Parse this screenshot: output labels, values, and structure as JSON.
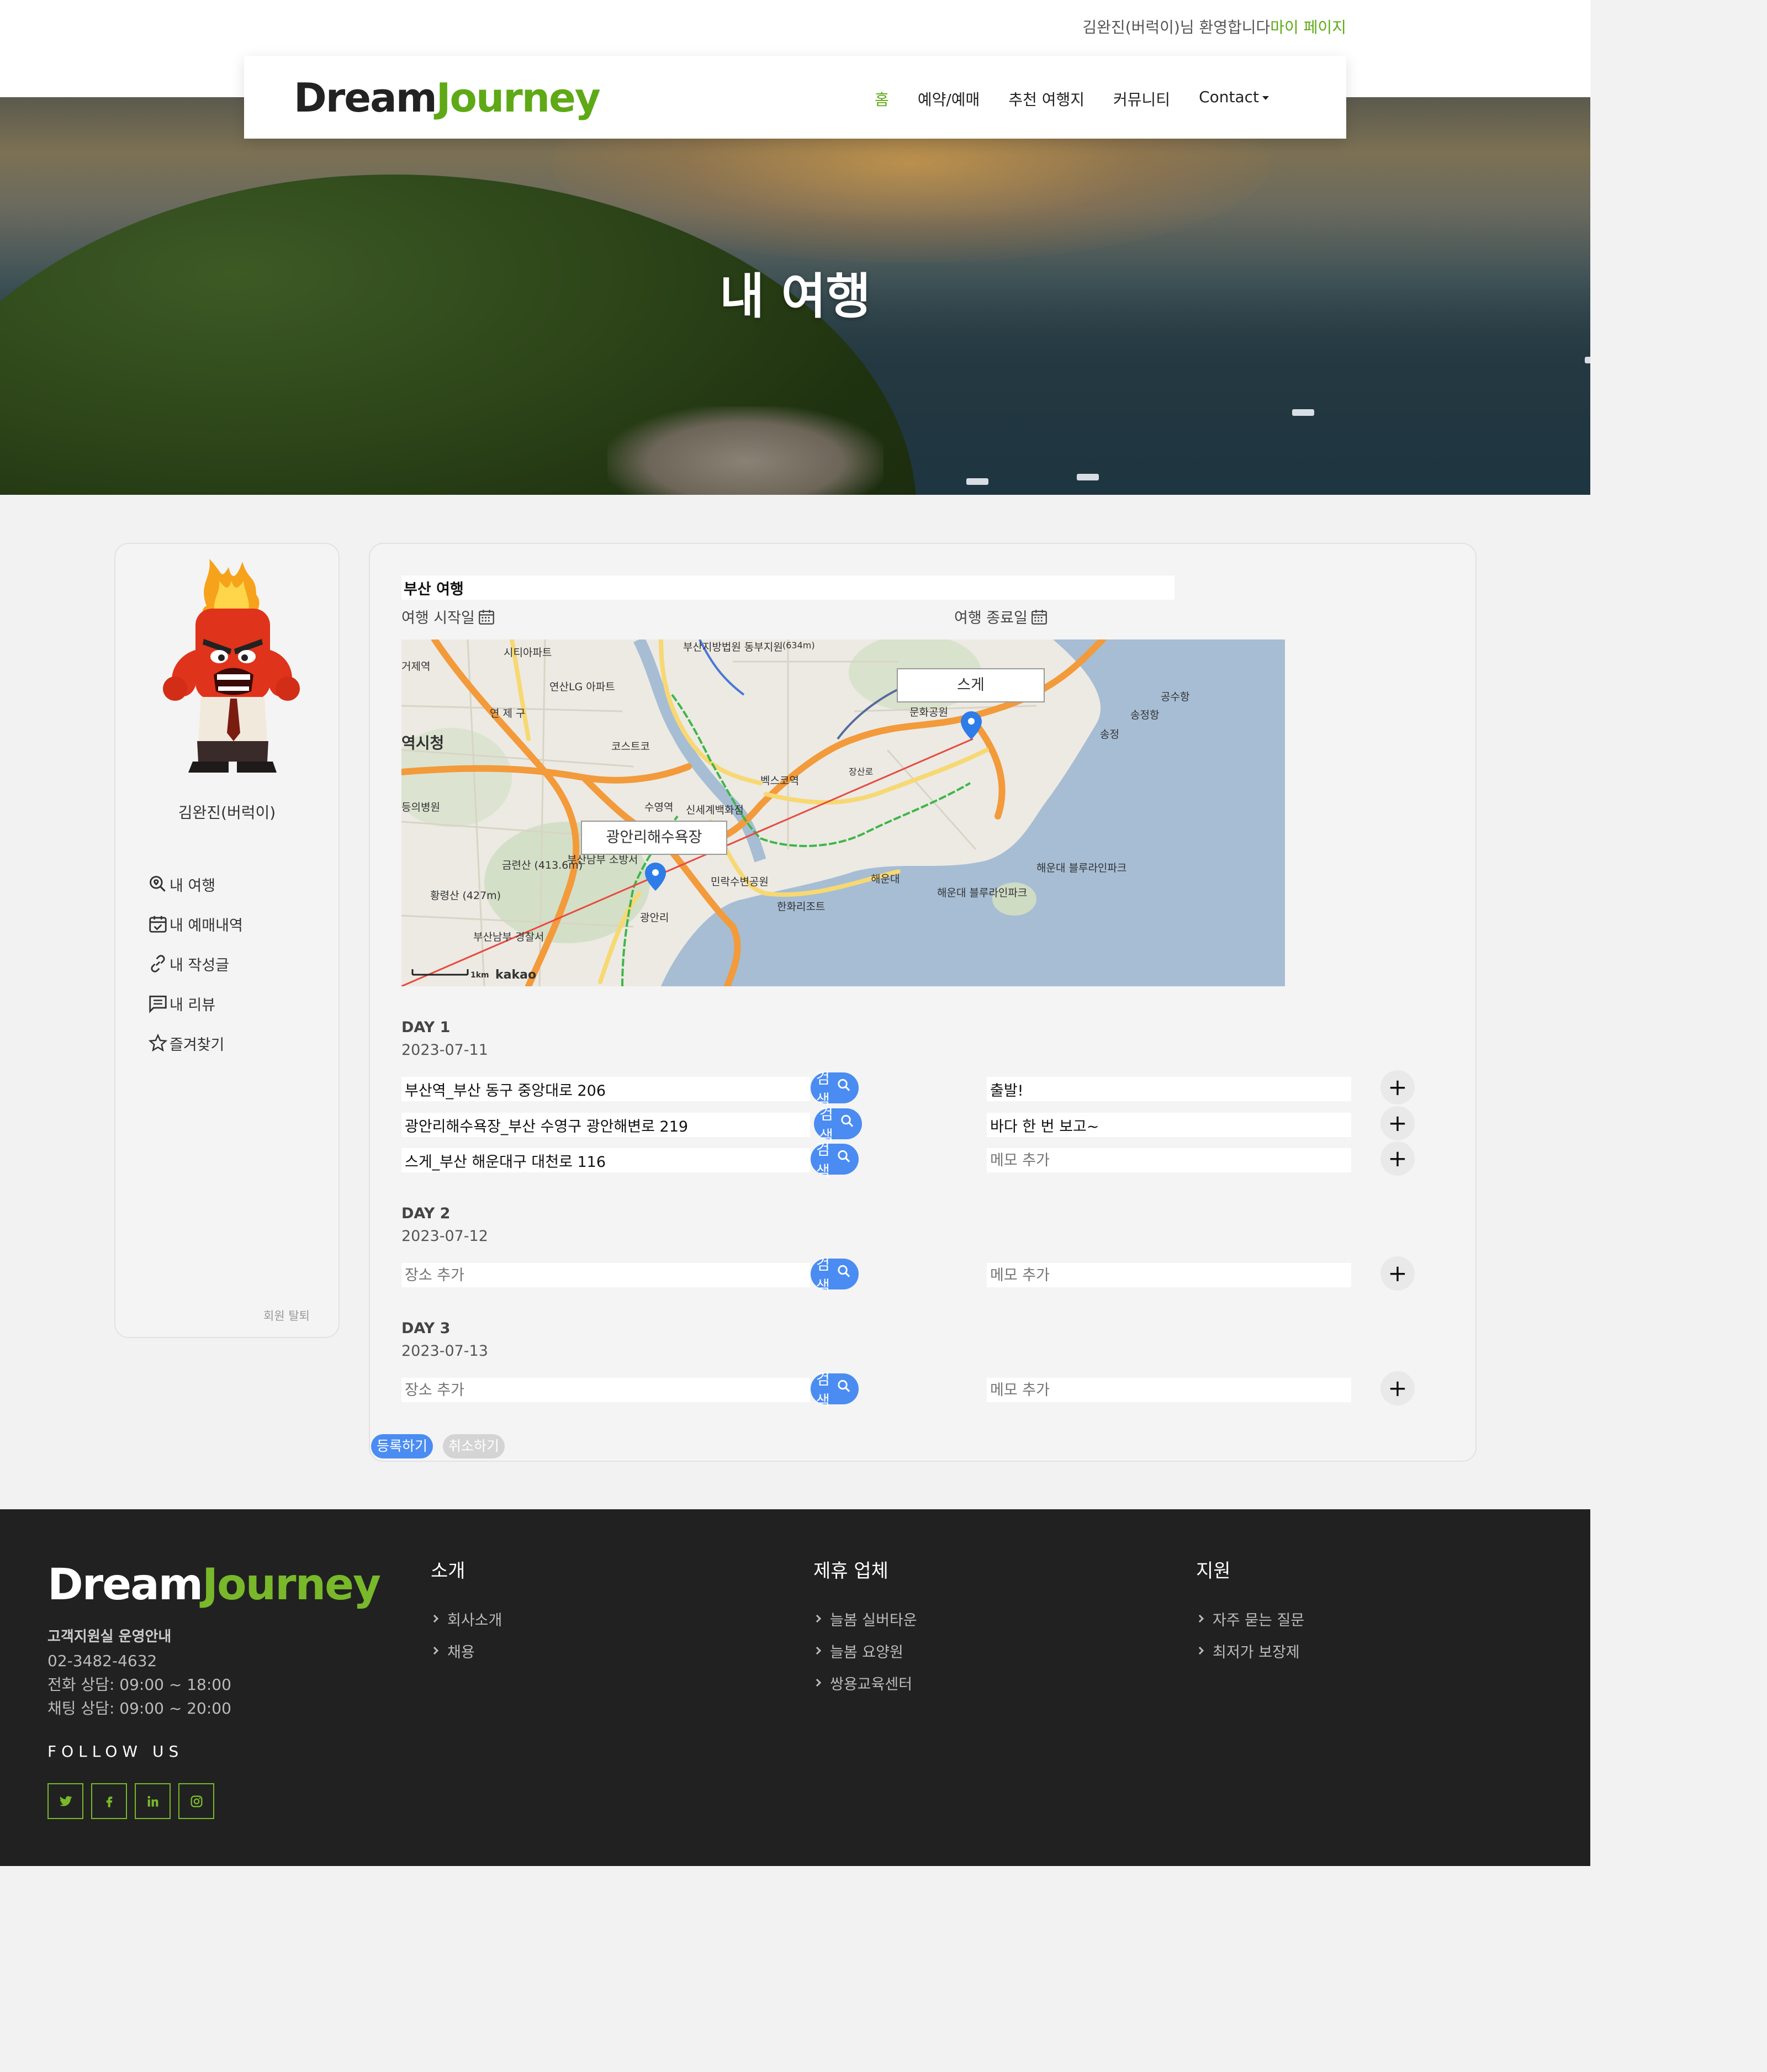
{
  "header": {
    "welcome_text": "김완진(버럭이)님 환영합니다",
    "mypage_link": "마이 페이지",
    "logo_part1": "Dream",
    "logo_part2": "Journey",
    "nav": [
      {
        "label": "홈",
        "active": true
      },
      {
        "label": "예약/예매"
      },
      {
        "label": "추천 여행지"
      },
      {
        "label": "커뮤니티"
      },
      {
        "label": "Contact",
        "dropdown": true
      }
    ]
  },
  "hero": {
    "title": "내 여행"
  },
  "sidebar": {
    "user_name": "김완진(버럭이)",
    "menu": [
      {
        "icon": "search-location-icon",
        "label": "내 여행"
      },
      {
        "icon": "calendar-check-icon",
        "label": "내 예매내역"
      },
      {
        "icon": "link-icon",
        "label": "내 작성글"
      },
      {
        "icon": "comment-icon",
        "label": "내 리뷰"
      },
      {
        "icon": "star-icon",
        "label": "즐겨찾기"
      }
    ],
    "withdraw_label": "회원 탈퇴"
  },
  "trip": {
    "name": "부산 여행",
    "start_label": "여행 시작일",
    "end_label": "여행 종료일",
    "map": {
      "pin_labels": [
        "스게",
        "광안리해수욕장"
      ],
      "labels": {
        "city_hall": "역시청",
        "yeonje": "연 제 구",
        "lg_apt": "연산LG 아파트",
        "citi_apt": "시티아파트",
        "court": "부산지방법원 동부지원",
        "hill634": "(634m)",
        "costco": "코스트코",
        "megabox": "벡스코역",
        "suyeong": "수영역",
        "shinsegae": "신세계백화점",
        "munhwa": "문화공원",
        "songjeong": "송정항",
        "gongsu": "공수항",
        "songjeong2": "송정",
        "jangsanno": "장산로",
        "haeundae": "해운대",
        "haeundae_park": "해운대 블루라인파크",
        "haeundae_park2": "해운대 블루라인파크",
        "minrak": "민락수변공원",
        "hanhwa": "한화리조트",
        "gwangalli": "광안리",
        "geumryun": "금련산 (413.6m)",
        "hwangryeong": "황령산 (427m)",
        "police": "부산남부 경찰서",
        "fire": "부산남부 소방서",
        "hospital": "등의병원",
        "exit": "거제역",
        "scale": "1km",
        "brand": "kakao"
      }
    },
    "days": [
      {
        "title": "DAY 1",
        "date": "2023-07-11",
        "rows": [
          {
            "place": "부산역_부산 동구 중앙대로 206",
            "memo": "출발!"
          },
          {
            "place": "광안리해수욕장_부산 수영구 광안해변로 219",
            "memo": "바다 한 번 보고~"
          },
          {
            "place": "스게_부산 해운대구 대천로 116",
            "memo": ""
          }
        ]
      },
      {
        "title": "DAY 2",
        "date": "2023-07-12",
        "rows": [
          {
            "place": "",
            "memo": ""
          }
        ]
      },
      {
        "title": "DAY 3",
        "date": "2023-07-13",
        "rows": [
          {
            "place": "",
            "memo": ""
          }
        ]
      }
    ],
    "place_placeholder": "장소 추가",
    "memo_placeholder": "메모 추가",
    "search_label": "검색",
    "plus_label": "+",
    "submit_label": "등록하기",
    "cancel_label": "취소하기"
  },
  "footer": {
    "logo_part1": "Dream",
    "logo_part2": "Journey",
    "support_title": "고객지원실 운영안내",
    "phone": "02-3482-4632",
    "call_hours": "전화 상담: 09:00 ~ 18:00",
    "chat_hours": "채팅 상담: 09:00 ~ 20:00",
    "follow_us": "FOLLOW US",
    "socials": [
      "twitter-icon",
      "facebook-icon",
      "linkedin-icon",
      "instagram-icon"
    ],
    "columns": [
      {
        "title": "소개",
        "links": [
          "회사소개",
          "채용"
        ]
      },
      {
        "title": "제휴 업체",
        "links": [
          "늘봄 실버타운",
          "늘봄 요양원",
          "쌍용교육센터"
        ]
      },
      {
        "title": "지원",
        "links": [
          "자주 묻는 질문",
          "최저가 보장제"
        ]
      }
    ]
  },
  "colors": {
    "brand_green": "#5ea915",
    "accent_blue": "#4a8cf2",
    "footer_bg": "#212121"
  }
}
